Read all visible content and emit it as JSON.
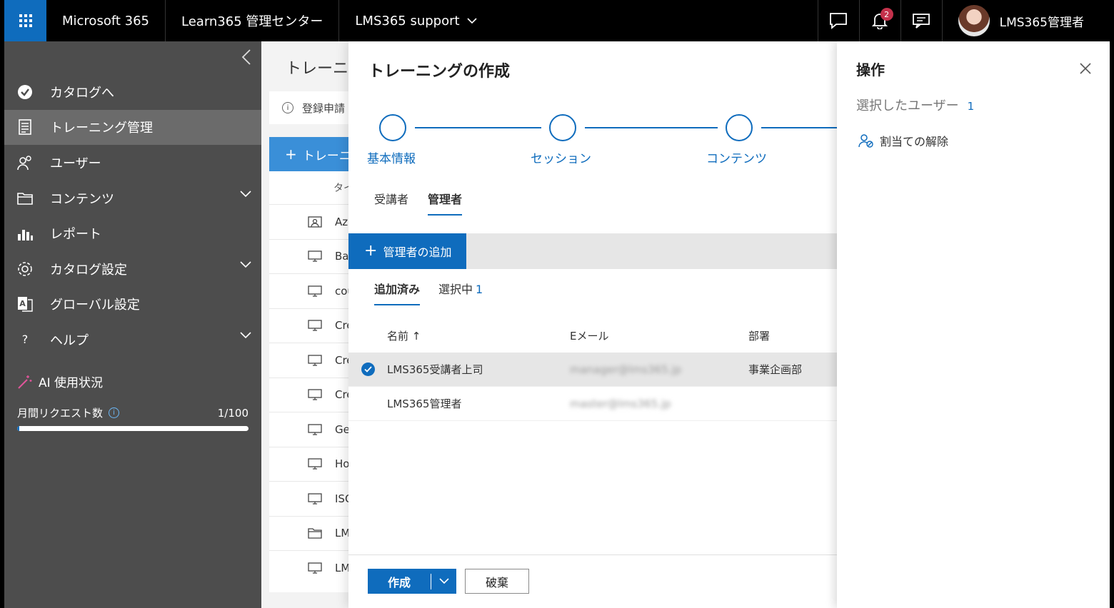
{
  "topbar": {
    "app_name": "Microsoft 365",
    "product": "Learn365 管理センター",
    "org": "LMS365 support",
    "notification_count": "2",
    "user_name": "LMS365管理者"
  },
  "sidebar": {
    "items": [
      {
        "label": "カタログへ",
        "icon": "catalog-check-icon"
      },
      {
        "label": "トレーニング管理",
        "icon": "training-doc-icon",
        "active": true
      },
      {
        "label": "ユーザー",
        "icon": "users-icon"
      },
      {
        "label": "コンテンツ",
        "icon": "folder-icon",
        "expandable": true
      },
      {
        "label": "レポート",
        "icon": "bar-chart-icon"
      },
      {
        "label": "カタログ設定",
        "icon": "gear-icon",
        "expandable": true
      },
      {
        "label": "グローバル設定",
        "icon": "translate-icon"
      },
      {
        "label": "ヘルプ",
        "icon": "question-icon",
        "expandable": true
      }
    ],
    "ai_title": "AI 使用状況",
    "ai_request_label": "月間リクエスト数",
    "ai_request_value": "1/100",
    "ai_progress": 0.01
  },
  "background_page": {
    "title": "トレーニング管理",
    "notice": "登録申請",
    "add_label": "トレーニング",
    "list_header": "タイトル",
    "rows": [
      {
        "text": "Azure",
        "icon": "classroom-icon"
      },
      {
        "text": "Basic",
        "icon": "monitor-icon"
      },
      {
        "text": "course",
        "icon": "monitor-icon"
      },
      {
        "text": "Create",
        "icon": "monitor-icon"
      },
      {
        "text": "Create",
        "icon": "monitor-icon"
      },
      {
        "text": "Create",
        "icon": "monitor-icon"
      },
      {
        "text": "Get",
        "icon": "monitor-icon"
      },
      {
        "text": "How",
        "icon": "monitor-icon"
      },
      {
        "text": "ISO",
        "icon": "monitor-icon"
      },
      {
        "text": "LMS",
        "icon": "folder-icon"
      },
      {
        "text": "LMS",
        "icon": "monitor-icon"
      }
    ]
  },
  "dialog": {
    "title": "トレーニングの作成",
    "steps": [
      "基本情報",
      "セッション",
      "コンテンツ"
    ],
    "pivots": [
      "受講者",
      "管理者"
    ],
    "add_manager_label": "管理者の追加",
    "subpivots": {
      "added": "追加済み",
      "selected": "選択中",
      "selected_count": "1"
    },
    "columns": {
      "name": "名前 ↑",
      "email": "Eメール",
      "department": "部署"
    },
    "rows": [
      {
        "name": "LMS365受講者上司",
        "email": "manager@lms365.jp",
        "department": "事業企画部",
        "selected": true
      },
      {
        "name": "LMS365管理者",
        "email": "master@lms365.jp",
        "department": "",
        "selected": false
      }
    ],
    "create_label": "作成",
    "discard_label": "破棄"
  },
  "panel": {
    "title": "操作",
    "selected_label": "選択したユーザー",
    "selected_count": "1",
    "action_label": "割当ての解除"
  },
  "colors": {
    "accent": "#0f6cbd",
    "sidebar": "#4d4d4d",
    "badge": "#c4314b"
  }
}
